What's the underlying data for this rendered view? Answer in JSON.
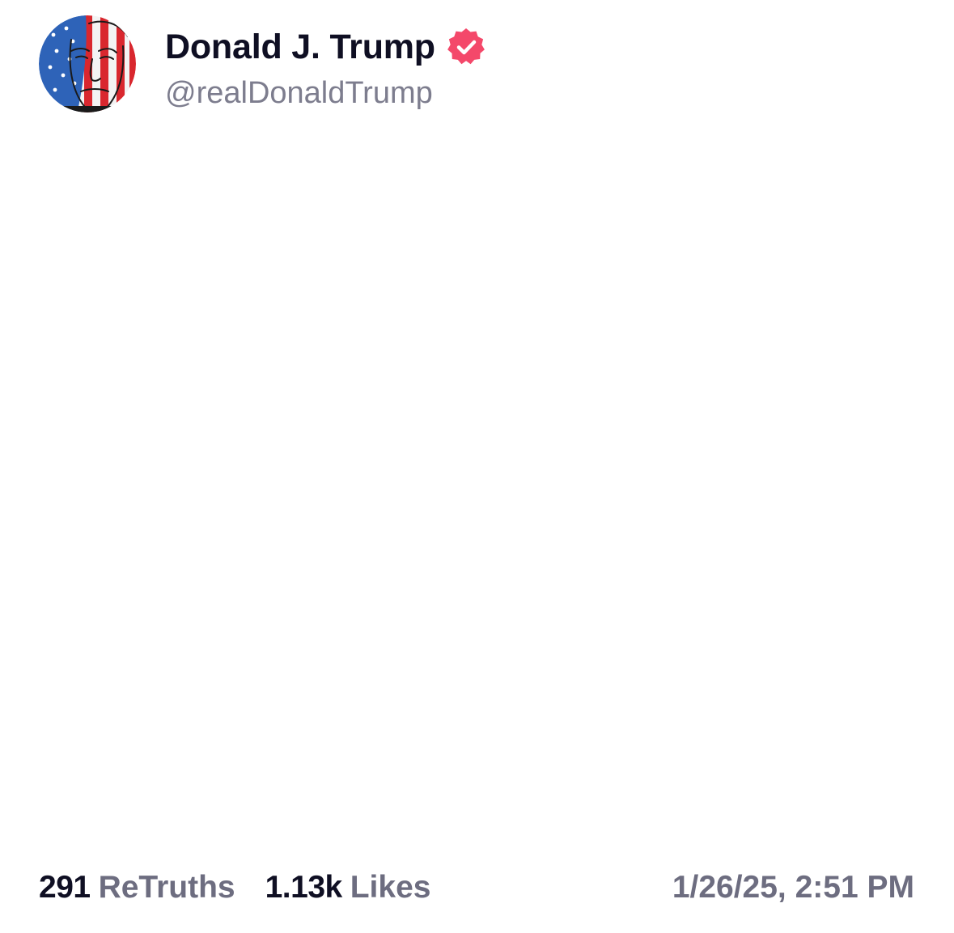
{
  "post": {
    "author": {
      "display_name": "Donald J. Trump",
      "handle": "@realDonaldTrump",
      "verified": true,
      "verified_icon": "verified-badge-icon",
      "verified_color": "#f4486a",
      "avatar_icon": "avatar-flag-portrait"
    },
    "stats": {
      "retruths_count": "291",
      "retruths_label": "ReTruths",
      "likes_count": "1.13k",
      "likes_label": "Likes"
    },
    "timestamp": "1/26/25, 2:51 PM"
  },
  "colors": {
    "name_text": "#0f0f23",
    "secondary_text": "#6d6d80",
    "handle_text": "#7d7d8e",
    "background": "#ffffff"
  }
}
